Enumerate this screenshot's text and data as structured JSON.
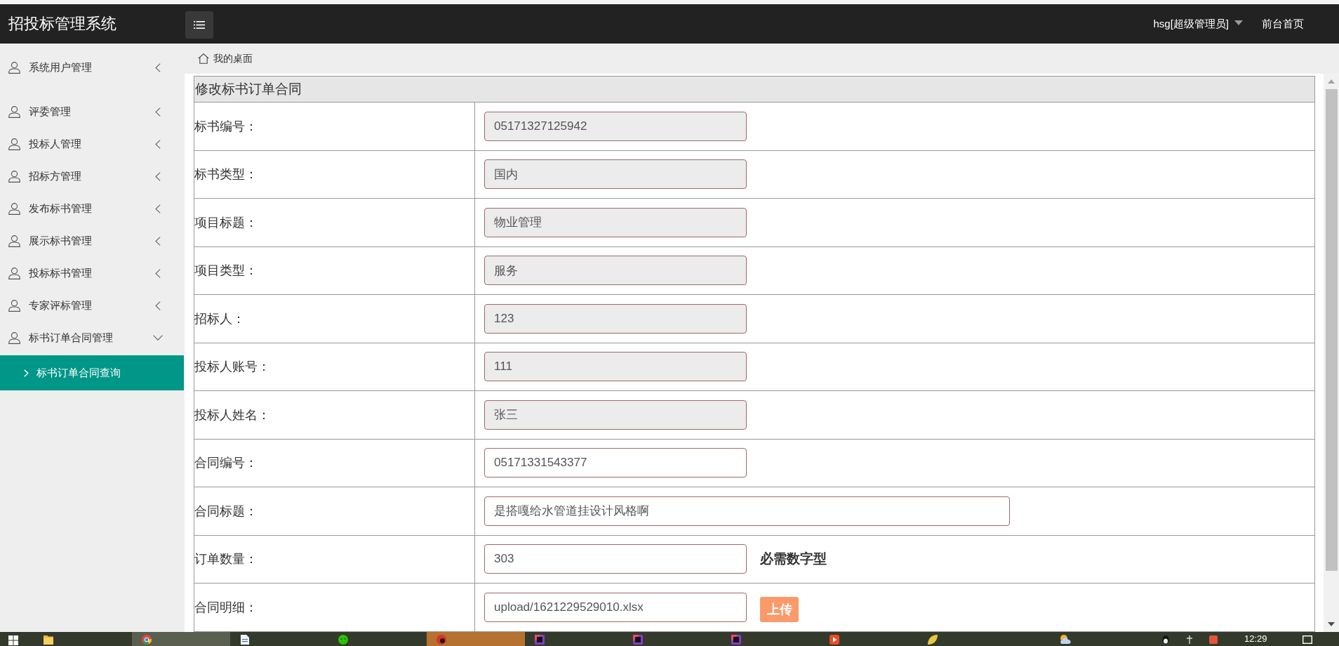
{
  "header": {
    "logo": "招投标管理系统",
    "user": "hsg[超级管理员]",
    "home_link": "前台首页"
  },
  "sidebar": {
    "items": [
      {
        "label": "系统用户管理",
        "expanded": false
      },
      {
        "label": "评委管理",
        "expanded": false
      },
      {
        "label": "投标人管理",
        "expanded": false
      },
      {
        "label": "招标方管理",
        "expanded": false
      },
      {
        "label": "发布标书管理",
        "expanded": false
      },
      {
        "label": "展示标书管理",
        "expanded": false
      },
      {
        "label": "投标标书管理",
        "expanded": false
      },
      {
        "label": "专家评标管理",
        "expanded": false
      },
      {
        "label": "标书订单合同管理",
        "expanded": true,
        "children": [
          {
            "label": "标书订单合同查询",
            "selected": true
          }
        ]
      }
    ]
  },
  "breadcrumb": {
    "label": "我的桌面"
  },
  "form": {
    "title": "修改标书订单合同",
    "rows": [
      {
        "label": "标书编号：",
        "kind": "text",
        "value": "05171327125942",
        "readonly": true
      },
      {
        "label": "标书类型：",
        "kind": "text",
        "value": "国内",
        "readonly": true
      },
      {
        "label": "项目标题：",
        "kind": "text",
        "value": "物业管理",
        "readonly": true
      },
      {
        "label": "项目类型：",
        "kind": "text",
        "value": "服务",
        "readonly": true
      },
      {
        "label": "招标人：",
        "kind": "text",
        "value": "123",
        "readonly": true
      },
      {
        "label": "投标人账号：",
        "kind": "text",
        "value": "111",
        "readonly": true
      },
      {
        "label": "投标人姓名：",
        "kind": "text",
        "value": "张三",
        "readonly": true
      },
      {
        "label": "合同编号：",
        "kind": "text",
        "value": "05171331543377",
        "readonly": false
      },
      {
        "label": "合同标题：",
        "kind": "long_text",
        "value": "是搭嘎给水管道挂设计风格啊",
        "readonly": false
      },
      {
        "label": "订单数量：",
        "kind": "number",
        "value": "303",
        "readonly": false,
        "note": "必需数字型"
      },
      {
        "label": "合同明细：",
        "kind": "file",
        "value": "upload/1621229529010.xlsx",
        "readonly": false,
        "button": "上传"
      }
    ]
  },
  "taskbar": {
    "buttons": [
      {
        "kind": "folder",
        "selected": false,
        "flashing": false
      },
      {
        "kind": "browser",
        "selected": true,
        "flashing": false
      },
      {
        "kind": "document",
        "selected": false,
        "flashing": false
      },
      {
        "kind": "chat",
        "selected": false,
        "flashing": false
      },
      {
        "kind": "app",
        "selected": false,
        "flashing": true
      },
      {
        "kind": "ide",
        "selected": false,
        "flashing": false
      },
      {
        "kind": "ide",
        "selected": false,
        "flashing": false
      },
      {
        "kind": "ide",
        "selected": false,
        "flashing": false
      },
      {
        "kind": "player",
        "selected": false,
        "flashing": false
      },
      {
        "kind": "notes",
        "selected": false,
        "flashing": false
      }
    ],
    "clock": "12:29"
  }
}
